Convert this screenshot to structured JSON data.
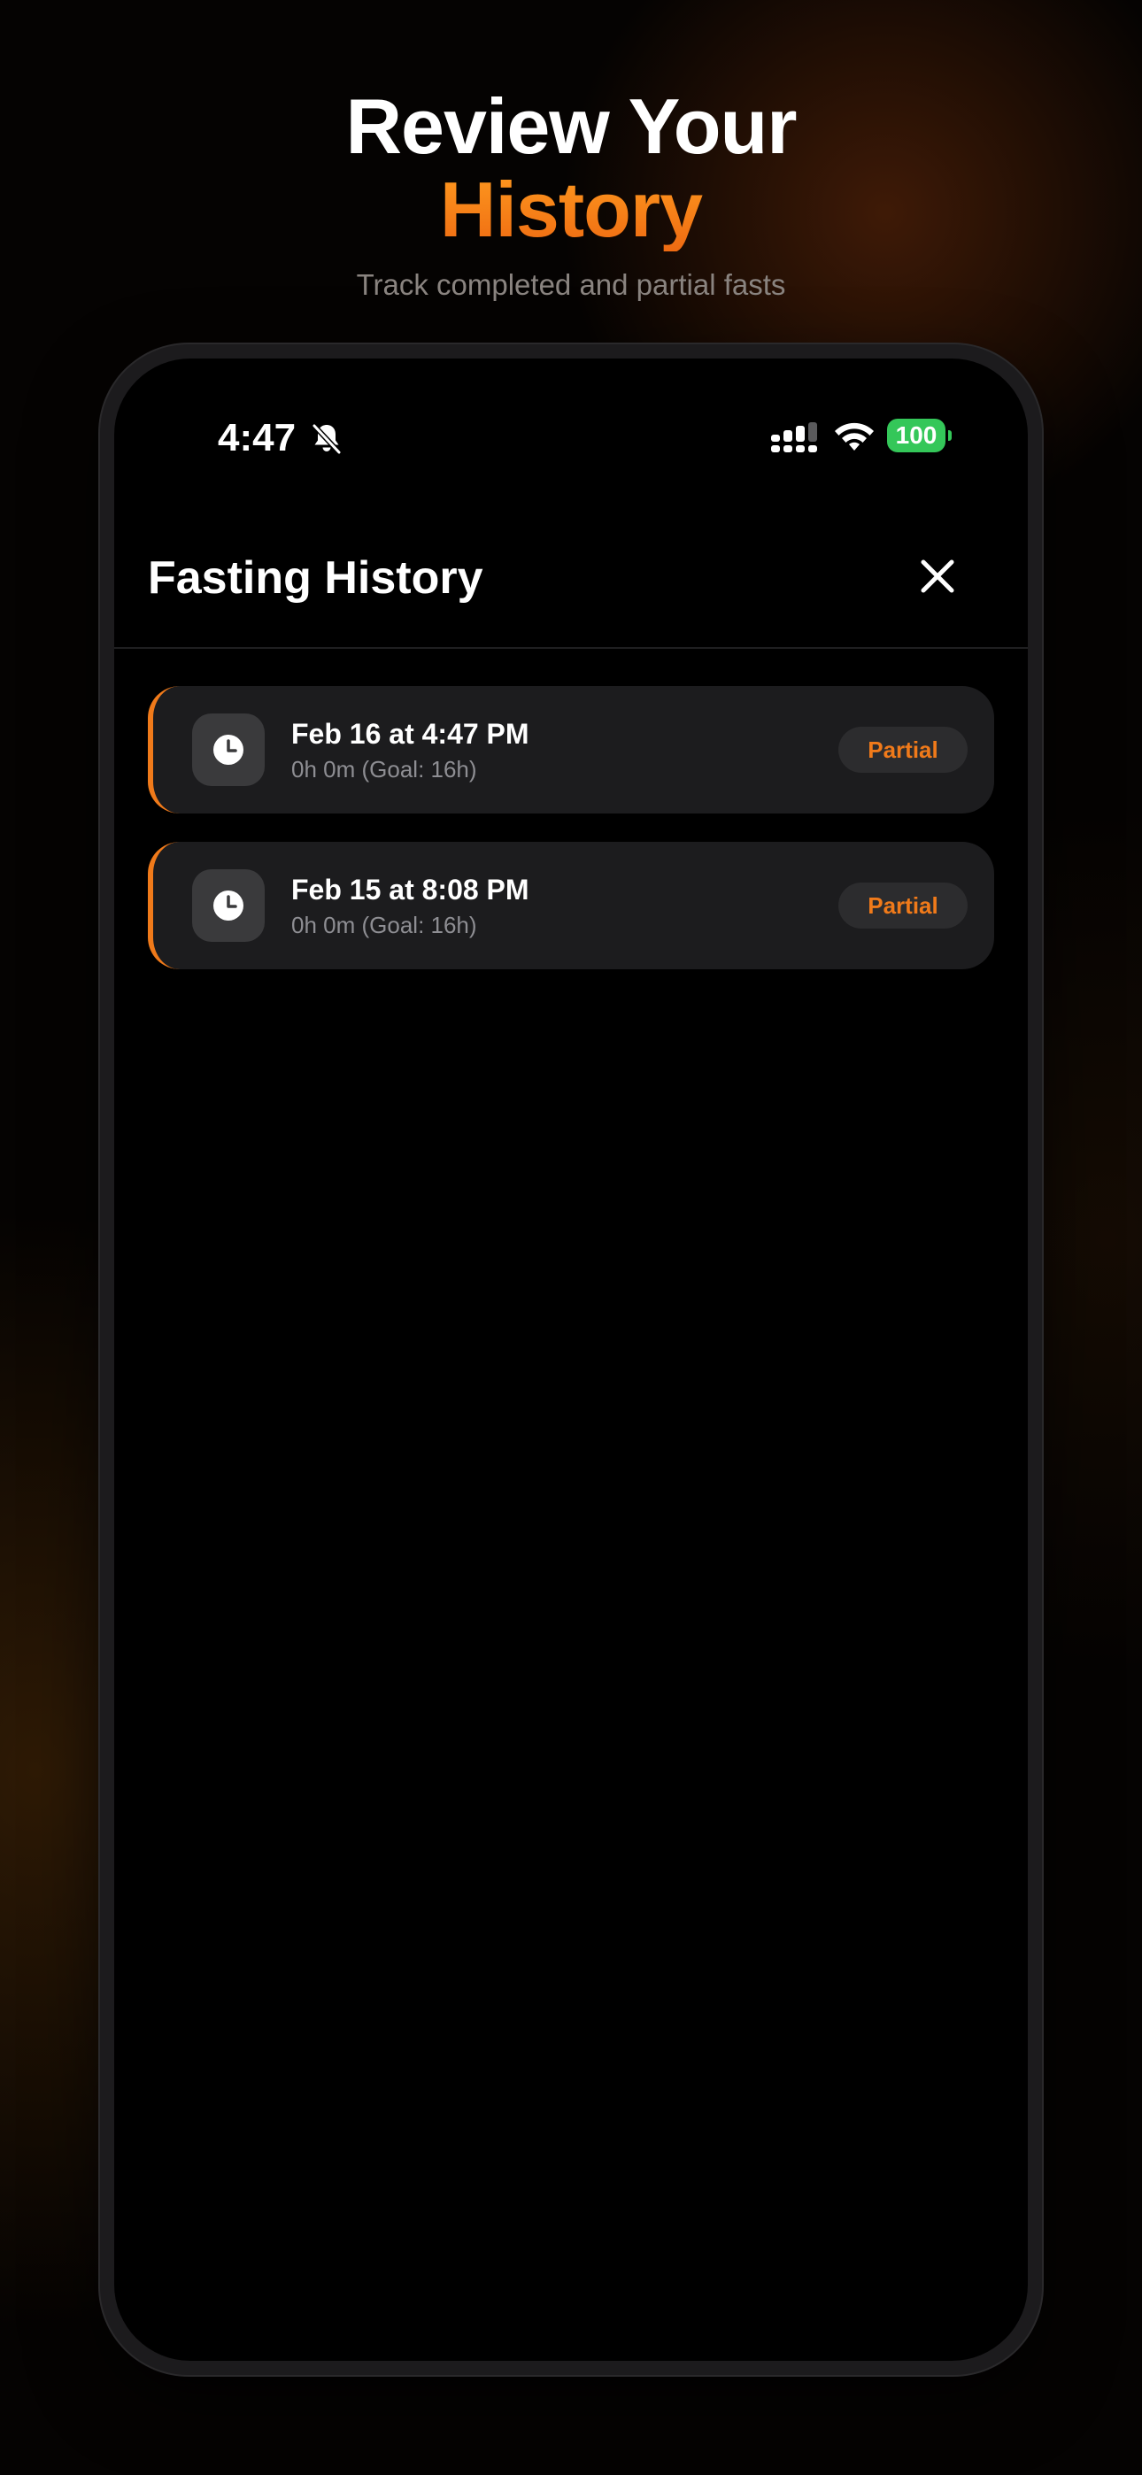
{
  "promo": {
    "headline_line1": "Review Your",
    "headline_line2": "History",
    "subtitle": "Track completed and partial fasts"
  },
  "status_bar": {
    "time": "4:47",
    "battery": "100",
    "icons": [
      "bell-slash-icon",
      "signal-icon",
      "wifi-icon",
      "battery-icon"
    ]
  },
  "header": {
    "title": "Fasting History",
    "close_icon": "close-icon"
  },
  "history": [
    {
      "date": "Feb 16 at 4:47 PM",
      "detail": "0h 0m (Goal: 16h)",
      "status": "Partial",
      "icon": "clock-icon"
    },
    {
      "date": "Feb 15 at 8:08 PM",
      "detail": "0h 0m (Goal: 16h)",
      "status": "Partial",
      "icon": "clock-icon"
    }
  ],
  "colors": {
    "accent": "#f07a1a",
    "card": "#1c1c1e",
    "battery": "#34c759",
    "background": "#000000"
  }
}
